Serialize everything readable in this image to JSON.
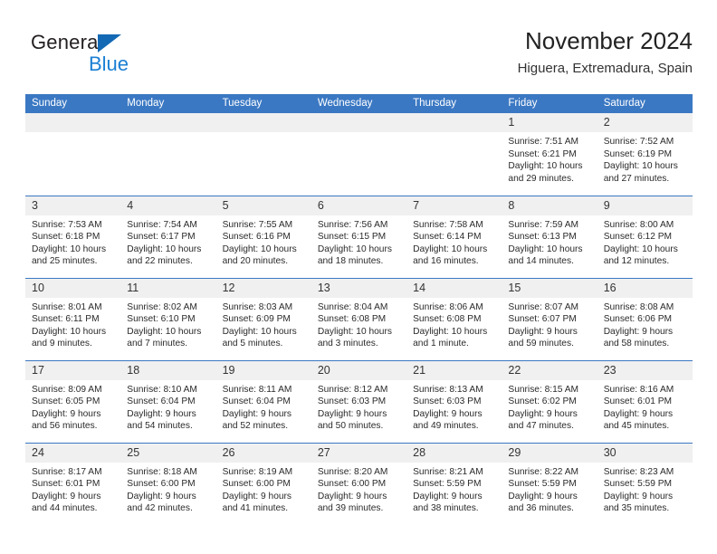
{
  "brand": {
    "name_part1": "General",
    "name_part2": "Blue",
    "accent_color": "#1b7fd4",
    "triangle_color": "#1469b5"
  },
  "header": {
    "title": "November 2024",
    "location": "Higuera, Extremadura, Spain"
  },
  "theme": {
    "header_blue": "#3b78c3",
    "daynum_band": "#f0f0f0",
    "text": "#222222"
  },
  "weekdays": [
    "Sunday",
    "Monday",
    "Tuesday",
    "Wednesday",
    "Thursday",
    "Friday",
    "Saturday"
  ],
  "labels": {
    "sunrise": "Sunrise:",
    "sunset": "Sunset:",
    "daylight": "Daylight:"
  },
  "weeks": [
    [
      {
        "empty": true
      },
      {
        "empty": true
      },
      {
        "empty": true
      },
      {
        "empty": true
      },
      {
        "empty": true
      },
      {
        "day": "1",
        "sunrise": "Sunrise: 7:51 AM",
        "sunset": "Sunset: 6:21 PM",
        "daylight1": "Daylight: 10 hours",
        "daylight2": "and 29 minutes."
      },
      {
        "day": "2",
        "sunrise": "Sunrise: 7:52 AM",
        "sunset": "Sunset: 6:19 PM",
        "daylight1": "Daylight: 10 hours",
        "daylight2": "and 27 minutes."
      }
    ],
    [
      {
        "day": "3",
        "sunrise": "Sunrise: 7:53 AM",
        "sunset": "Sunset: 6:18 PM",
        "daylight1": "Daylight: 10 hours",
        "daylight2": "and 25 minutes."
      },
      {
        "day": "4",
        "sunrise": "Sunrise: 7:54 AM",
        "sunset": "Sunset: 6:17 PM",
        "daylight1": "Daylight: 10 hours",
        "daylight2": "and 22 minutes."
      },
      {
        "day": "5",
        "sunrise": "Sunrise: 7:55 AM",
        "sunset": "Sunset: 6:16 PM",
        "daylight1": "Daylight: 10 hours",
        "daylight2": "and 20 minutes."
      },
      {
        "day": "6",
        "sunrise": "Sunrise: 7:56 AM",
        "sunset": "Sunset: 6:15 PM",
        "daylight1": "Daylight: 10 hours",
        "daylight2": "and 18 minutes."
      },
      {
        "day": "7",
        "sunrise": "Sunrise: 7:58 AM",
        "sunset": "Sunset: 6:14 PM",
        "daylight1": "Daylight: 10 hours",
        "daylight2": "and 16 minutes."
      },
      {
        "day": "8",
        "sunrise": "Sunrise: 7:59 AM",
        "sunset": "Sunset: 6:13 PM",
        "daylight1": "Daylight: 10 hours",
        "daylight2": "and 14 minutes."
      },
      {
        "day": "9",
        "sunrise": "Sunrise: 8:00 AM",
        "sunset": "Sunset: 6:12 PM",
        "daylight1": "Daylight: 10 hours",
        "daylight2": "and 12 minutes."
      }
    ],
    [
      {
        "day": "10",
        "sunrise": "Sunrise: 8:01 AM",
        "sunset": "Sunset: 6:11 PM",
        "daylight1": "Daylight: 10 hours",
        "daylight2": "and 9 minutes."
      },
      {
        "day": "11",
        "sunrise": "Sunrise: 8:02 AM",
        "sunset": "Sunset: 6:10 PM",
        "daylight1": "Daylight: 10 hours",
        "daylight2": "and 7 minutes."
      },
      {
        "day": "12",
        "sunrise": "Sunrise: 8:03 AM",
        "sunset": "Sunset: 6:09 PM",
        "daylight1": "Daylight: 10 hours",
        "daylight2": "and 5 minutes."
      },
      {
        "day": "13",
        "sunrise": "Sunrise: 8:04 AM",
        "sunset": "Sunset: 6:08 PM",
        "daylight1": "Daylight: 10 hours",
        "daylight2": "and 3 minutes."
      },
      {
        "day": "14",
        "sunrise": "Sunrise: 8:06 AM",
        "sunset": "Sunset: 6:08 PM",
        "daylight1": "Daylight: 10 hours",
        "daylight2": "and 1 minute."
      },
      {
        "day": "15",
        "sunrise": "Sunrise: 8:07 AM",
        "sunset": "Sunset: 6:07 PM",
        "daylight1": "Daylight: 9 hours",
        "daylight2": "and 59 minutes."
      },
      {
        "day": "16",
        "sunrise": "Sunrise: 8:08 AM",
        "sunset": "Sunset: 6:06 PM",
        "daylight1": "Daylight: 9 hours",
        "daylight2": "and 58 minutes."
      }
    ],
    [
      {
        "day": "17",
        "sunrise": "Sunrise: 8:09 AM",
        "sunset": "Sunset: 6:05 PM",
        "daylight1": "Daylight: 9 hours",
        "daylight2": "and 56 minutes."
      },
      {
        "day": "18",
        "sunrise": "Sunrise: 8:10 AM",
        "sunset": "Sunset: 6:04 PM",
        "daylight1": "Daylight: 9 hours",
        "daylight2": "and 54 minutes."
      },
      {
        "day": "19",
        "sunrise": "Sunrise: 8:11 AM",
        "sunset": "Sunset: 6:04 PM",
        "daylight1": "Daylight: 9 hours",
        "daylight2": "and 52 minutes."
      },
      {
        "day": "20",
        "sunrise": "Sunrise: 8:12 AM",
        "sunset": "Sunset: 6:03 PM",
        "daylight1": "Daylight: 9 hours",
        "daylight2": "and 50 minutes."
      },
      {
        "day": "21",
        "sunrise": "Sunrise: 8:13 AM",
        "sunset": "Sunset: 6:03 PM",
        "daylight1": "Daylight: 9 hours",
        "daylight2": "and 49 minutes."
      },
      {
        "day": "22",
        "sunrise": "Sunrise: 8:15 AM",
        "sunset": "Sunset: 6:02 PM",
        "daylight1": "Daylight: 9 hours",
        "daylight2": "and 47 minutes."
      },
      {
        "day": "23",
        "sunrise": "Sunrise: 8:16 AM",
        "sunset": "Sunset: 6:01 PM",
        "daylight1": "Daylight: 9 hours",
        "daylight2": "and 45 minutes."
      }
    ],
    [
      {
        "day": "24",
        "sunrise": "Sunrise: 8:17 AM",
        "sunset": "Sunset: 6:01 PM",
        "daylight1": "Daylight: 9 hours",
        "daylight2": "and 44 minutes."
      },
      {
        "day": "25",
        "sunrise": "Sunrise: 8:18 AM",
        "sunset": "Sunset: 6:00 PM",
        "daylight1": "Daylight: 9 hours",
        "daylight2": "and 42 minutes."
      },
      {
        "day": "26",
        "sunrise": "Sunrise: 8:19 AM",
        "sunset": "Sunset: 6:00 PM",
        "daylight1": "Daylight: 9 hours",
        "daylight2": "and 41 minutes."
      },
      {
        "day": "27",
        "sunrise": "Sunrise: 8:20 AM",
        "sunset": "Sunset: 6:00 PM",
        "daylight1": "Daylight: 9 hours",
        "daylight2": "and 39 minutes."
      },
      {
        "day": "28",
        "sunrise": "Sunrise: 8:21 AM",
        "sunset": "Sunset: 5:59 PM",
        "daylight1": "Daylight: 9 hours",
        "daylight2": "and 38 minutes."
      },
      {
        "day": "29",
        "sunrise": "Sunrise: 8:22 AM",
        "sunset": "Sunset: 5:59 PM",
        "daylight1": "Daylight: 9 hours",
        "daylight2": "and 36 minutes."
      },
      {
        "day": "30",
        "sunrise": "Sunrise: 8:23 AM",
        "sunset": "Sunset: 5:59 PM",
        "daylight1": "Daylight: 9 hours",
        "daylight2": "and 35 minutes."
      }
    ]
  ]
}
